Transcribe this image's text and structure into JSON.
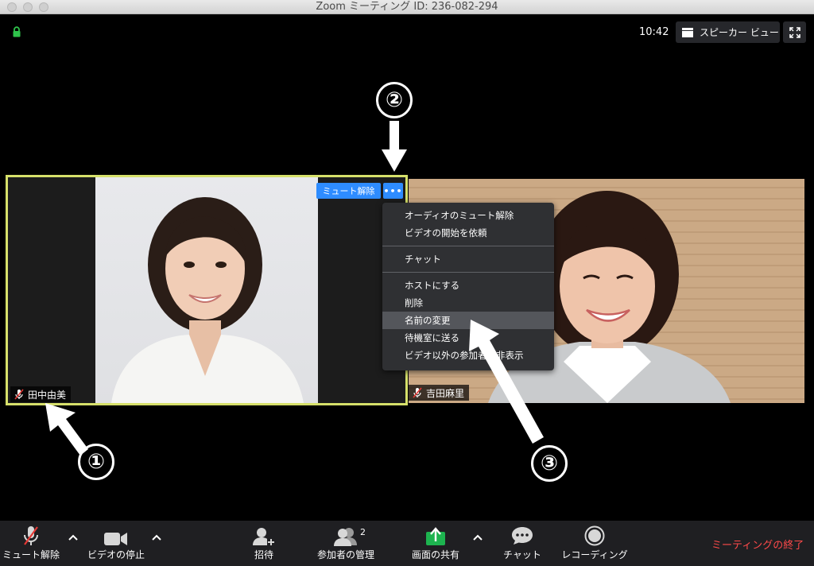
{
  "window": {
    "title": "Zoom ミーティング ID: 236-082-294"
  },
  "header": {
    "time": "10:42",
    "speaker_view_label": "スピーカー ビュー"
  },
  "participant1": {
    "name": "田中由美",
    "unmute_label": "ミュート解除",
    "more_label": "•••"
  },
  "participant2": {
    "name": "吉田麻里"
  },
  "context_menu": {
    "items": [
      "オーディオのミュート解除",
      "ビデオの開始を依頼",
      "チャット",
      "ホストにする",
      "削除",
      "名前の変更",
      "待機室に送る",
      "ビデオ以外の参加者を非表示"
    ],
    "highlighted": "名前の変更"
  },
  "annotations": {
    "n1": "①",
    "n2": "②",
    "n3": "③"
  },
  "toolbar": {
    "unmute": "ミュート解除",
    "stop_video": "ビデオの停止",
    "invite": "招待",
    "participants": "参加者の管理",
    "participants_count": "2",
    "share_screen": "画面の共有",
    "chat": "チャット",
    "record": "レコーディング",
    "end_meeting": "ミーティングの終了"
  },
  "colors": {
    "accent_blue": "#2e8cff",
    "active_speaker_border": "#d6e06a",
    "share_green": "#1db34f",
    "end_red": "#ff4a4a"
  }
}
